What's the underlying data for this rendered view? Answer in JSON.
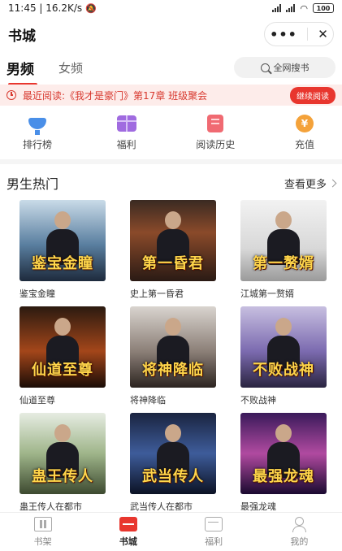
{
  "status_bar": {
    "time_speed": "11:45 | 16.2K/s",
    "battery": "100"
  },
  "header": {
    "title": "书城",
    "more_label": "•••",
    "close_label": "✕"
  },
  "tabs": [
    {
      "label": "男频",
      "active": true
    },
    {
      "label": "女频",
      "active": false
    }
  ],
  "search": {
    "placeholder": "全网搜书"
  },
  "recent_reading": {
    "text": "最近阅读:《我才是豪门》第17章 班级聚会",
    "button_label": "继续阅读"
  },
  "quick_nav": [
    {
      "label": "排行榜",
      "icon": "trophy-icon"
    },
    {
      "label": "福利",
      "icon": "gift-icon"
    },
    {
      "label": "阅读历史",
      "icon": "history-icon"
    },
    {
      "label": "充值",
      "icon": "coin-icon",
      "glyph": "¥"
    }
  ],
  "section": {
    "title": "男生热门",
    "see_more": "查看更多"
  },
  "books": [
    {
      "title": "鉴宝金瞳",
      "cover_text": "鉴宝金瞳",
      "bg": "linear-gradient(180deg,#c9dbe8 0%,#5a7fa0 55%,#1d2a3c 100%)"
    },
    {
      "title": "史上第一昏君",
      "cover_text": "第一昏君",
      "bg": "linear-gradient(180deg,#3a2a22 0%,#8a4a2a 40%,#2a1a14 100%)"
    },
    {
      "title": "江城第一赘婿",
      "cover_text": "第一赘婿",
      "bg": "linear-gradient(180deg,#f2f2f2 0%,#d8d8d8 60%,#9a9a9a 100%)"
    },
    {
      "title": "仙道至尊",
      "cover_text": "仙道至尊",
      "bg": "linear-gradient(180deg,#2b1a10 0%,#a3461a 55%,#1a0c06 100%)"
    },
    {
      "title": "将神降临",
      "cover_text": "将神降临",
      "bg": "linear-gradient(180deg,#d9d4cf 0%,#8c8078 55%,#2c2420 100%)"
    },
    {
      "title": "不败战神",
      "cover_text": "不败战神",
      "bg": "linear-gradient(180deg,#c7bfe0 0%,#7c6bb0 55%,#2a2440 100%)"
    },
    {
      "title": "蛊王传人在都市",
      "cover_text": "蛊王传人",
      "bg": "linear-gradient(180deg,#e6ece2 0%,#9fb58a 50%,#3d4a30 100%)"
    },
    {
      "title": "武当传人在都市",
      "cover_text": "武当传人",
      "bg": "linear-gradient(180deg,#1a2440 0%,#3e5c9a 50%,#0c1224 100%)"
    },
    {
      "title": "最强龙魂",
      "cover_text": "最强龙魂",
      "bg": "linear-gradient(180deg,#3a1a5a 0%,#b04aa0 50%,#1a0a30 100%)"
    }
  ],
  "bottom_nav": [
    {
      "label": "书架",
      "icon": "bookshelf-icon",
      "active": false
    },
    {
      "label": "书城",
      "icon": "bookstore-icon",
      "active": true
    },
    {
      "label": "福利",
      "icon": "welfare-icon",
      "active": false
    },
    {
      "label": "我的",
      "icon": "profile-icon",
      "active": false
    }
  ]
}
